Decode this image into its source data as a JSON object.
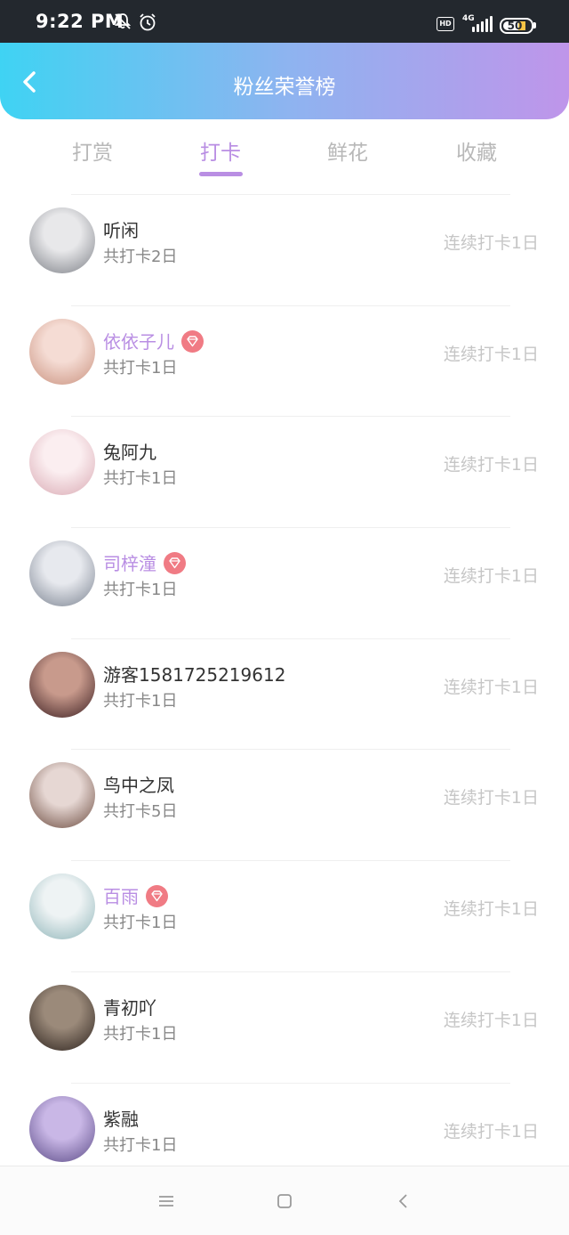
{
  "status": {
    "time": "9:22 PM",
    "hd": "HD",
    "network": "4G",
    "battery": "50"
  },
  "header": {
    "title": "粉丝荣誉榜"
  },
  "tabs": [
    {
      "label": "打赏",
      "active": false
    },
    {
      "label": "打卡",
      "active": true
    },
    {
      "label": "鲜花",
      "active": false
    },
    {
      "label": "收藏",
      "active": false
    }
  ],
  "colors": {
    "accent": "#b98ee3",
    "vip_badge": "#f07b84",
    "header_start": "#3fd3f3",
    "header_end": "#bf95ea"
  },
  "fans": [
    {
      "name": "听闲",
      "total": "共打卡2日",
      "streak": "连续打卡1日",
      "vip": false,
      "avatar": [
        "#e8e8ea",
        "#7c7f86"
      ]
    },
    {
      "name": "依依子儿",
      "total": "共打卡1日",
      "streak": "连续打卡1日",
      "vip": true,
      "avatar": [
        "#f5dcd4",
        "#c9917e"
      ]
    },
    {
      "name": "兔阿九",
      "total": "共打卡1日",
      "streak": "连续打卡1日",
      "vip": false,
      "avatar": [
        "#fbeef0",
        "#d9a9b3"
      ]
    },
    {
      "name": "司梓潼",
      "total": "共打卡1日",
      "streak": "连续打卡1日",
      "vip": true,
      "avatar": [
        "#e7e9ee",
        "#7a8290"
      ]
    },
    {
      "name": "游客1581725219612",
      "total": "共打卡1日",
      "streak": "连续打卡1日",
      "vip": false,
      "avatar": [
        "#c89a8c",
        "#3a1d20"
      ]
    },
    {
      "name": "鸟中之凤",
      "total": "共打卡5日",
      "streak": "连续打卡1日",
      "vip": false,
      "avatar": [
        "#e6d7d3",
        "#6b4a3e"
      ]
    },
    {
      "name": "百雨",
      "total": "共打卡1日",
      "streak": "连续打卡1日",
      "vip": true,
      "avatar": [
        "#eef3f4",
        "#8fb5b9"
      ]
    },
    {
      "name": "青初吖",
      "total": "共打卡1日",
      "streak": "连续打卡1日",
      "vip": false,
      "avatar": [
        "#9b8a7a",
        "#2b211c"
      ]
    },
    {
      "name": "紫融",
      "total": "共打卡1日",
      "streak": "连续打卡1日",
      "vip": false,
      "avatar": [
        "#c9b7e6",
        "#5a4a86"
      ]
    }
  ],
  "navbar": {
    "icons": [
      "menu-icon",
      "home-square-icon",
      "back-chevron-icon"
    ]
  }
}
